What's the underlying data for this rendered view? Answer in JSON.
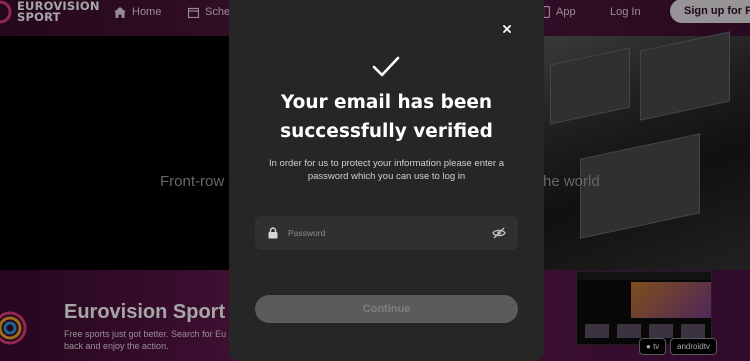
{
  "header": {
    "logo_line1": "EUROVISION",
    "logo_line2": "SPORT",
    "nav": {
      "home": "Home",
      "schedule": "Sche",
      "app": "App",
      "login": "Log In",
      "signup": "Sign up for Fre"
    }
  },
  "hero": {
    "tagline_left": "Front-row",
    "tagline_right": "he world"
  },
  "promo": {
    "title": "Eurovision Sport",
    "desc_line1": "Free sports just got better. Search for Eu",
    "desc_line2": "back and enjoy the action.",
    "store_apple": "tv",
    "store_android": "androidtv"
  },
  "modal": {
    "title_line1": "Your email has been",
    "title_line2": "successfully verified",
    "description": "In order for us to protect your information please enter a password which you can use to log in",
    "password_placeholder": "Password",
    "password_value": "",
    "continue_label": "Continue"
  },
  "colors": {
    "modal_bg": "#262626",
    "input_bg": "#303030",
    "button_disabled_bg": "#5b5b5b",
    "brand_purple": "#541a42"
  },
  "icons": {
    "close": "close-icon",
    "success": "checkmark-icon",
    "lock": "lock-icon",
    "visibility": "eye-off-icon",
    "home": "home-icon",
    "schedule": "calendar-icon",
    "app": "phone-icon"
  }
}
